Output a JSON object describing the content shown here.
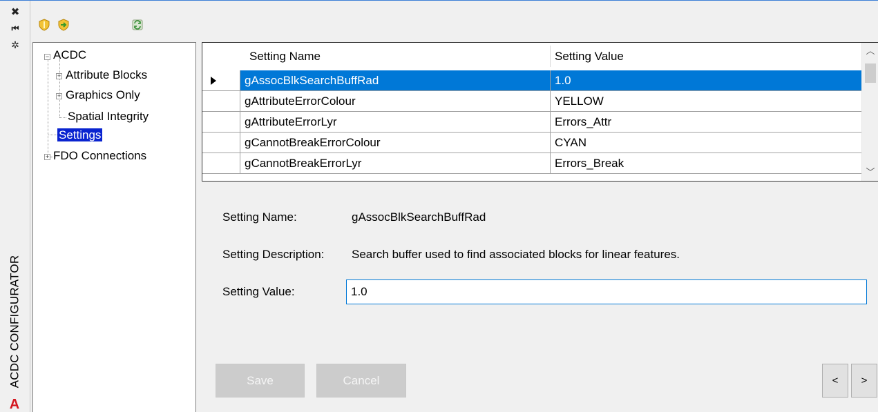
{
  "palette": {
    "title": "ACDC CONFIGURATOR",
    "buttons": [
      "close-icon",
      "pin-icon",
      "properties-icon"
    ],
    "logo_letter": "A"
  },
  "toolbar": {
    "icons": [
      "shield-icon",
      "shield-arrow-icon",
      "refresh-icon"
    ]
  },
  "tree": {
    "root": "ACDC",
    "children": [
      "Attribute Blocks",
      "Graphics Only",
      "Spatial Integrity"
    ],
    "settings": "Settings",
    "fdo": "FDO Connections"
  },
  "grid": {
    "headers": [
      "Setting Name",
      "Setting Value"
    ],
    "rows": [
      {
        "name": "gAssocBlkSearchBuffRad",
        "value": "1.0"
      },
      {
        "name": "gAttributeErrorColour",
        "value": "YELLOW"
      },
      {
        "name": "gAttributeErrorLyr",
        "value": "Errors_Attr"
      },
      {
        "name": "gCannotBreakErrorColour",
        "value": "CYAN"
      },
      {
        "name": "gCannotBreakErrorLyr",
        "value": "Errors_Break"
      }
    ]
  },
  "details": {
    "name_label": "Setting Name:",
    "name_value": "gAssocBlkSearchBuffRad",
    "desc_label": "Setting Description:",
    "desc_value": "Search buffer used to find associated blocks for linear features.",
    "value_label": "Setting Value:",
    "value": "1.0"
  },
  "buttons": {
    "save": "Save",
    "cancel": "Cancel",
    "prev": "<",
    "next": ">"
  },
  "colors": {
    "selection": "#0078d7",
    "tree_selection": "#0a24d0",
    "logo": "#d4161f"
  }
}
